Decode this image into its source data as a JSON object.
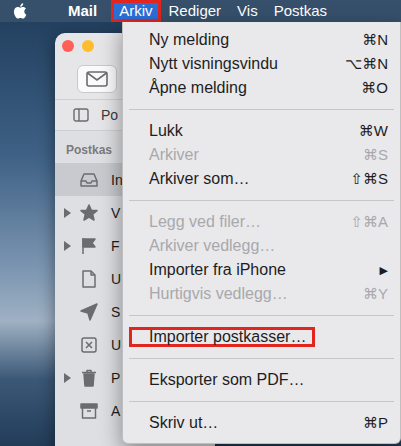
{
  "menubar": {
    "items": [
      {
        "label": "Mail",
        "kind": "app",
        "selected": false,
        "highlighted": false
      },
      {
        "label": "Arkiv",
        "kind": "menu",
        "selected": true,
        "highlighted": true
      },
      {
        "label": "Rediger",
        "kind": "menu",
        "selected": false,
        "highlighted": false
      },
      {
        "label": "Vis",
        "kind": "menu",
        "selected": false,
        "highlighted": false
      },
      {
        "label": "Postkas",
        "kind": "menu",
        "selected": false,
        "highlighted": false
      }
    ]
  },
  "mail_window": {
    "tab_label": "Po",
    "sidebar_header": "Postkas",
    "sidebar_items": [
      {
        "label": "In",
        "kind": "inbox",
        "expandable": false,
        "selected": true
      },
      {
        "label": "V",
        "kind": "star",
        "expandable": true,
        "selected": false
      },
      {
        "label": "F",
        "kind": "flag",
        "expandable": true,
        "selected": false
      },
      {
        "label": "U",
        "kind": "draft",
        "expandable": false,
        "selected": false
      },
      {
        "label": "S",
        "kind": "sent",
        "expandable": false,
        "selected": false
      },
      {
        "label": "U",
        "kind": "junk",
        "expandable": false,
        "selected": false
      },
      {
        "label": "P",
        "kind": "trash",
        "expandable": true,
        "selected": false
      },
      {
        "label": "A",
        "kind": "archive",
        "expandable": false,
        "selected": false
      }
    ]
  },
  "menu": {
    "entries": [
      {
        "kind": "item",
        "label": "Ny melding",
        "shortcut": "⌘N",
        "disabled": false,
        "highlighted": false
      },
      {
        "kind": "item",
        "label": "Nytt visningsvindu",
        "shortcut": "⌥⌘N",
        "disabled": false,
        "highlighted": false
      },
      {
        "kind": "item",
        "label": "Åpne melding",
        "shortcut": "⌘O",
        "disabled": false,
        "highlighted": false
      },
      {
        "kind": "separator"
      },
      {
        "kind": "item",
        "label": "Lukk",
        "shortcut": "⌘W",
        "disabled": false,
        "highlighted": false
      },
      {
        "kind": "item",
        "label": "Arkiver",
        "shortcut": "⌘S",
        "disabled": true,
        "highlighted": false
      },
      {
        "kind": "item",
        "label": "Arkiver som…",
        "shortcut": "⇧⌘S",
        "disabled": false,
        "highlighted": false
      },
      {
        "kind": "separator"
      },
      {
        "kind": "item",
        "label": "Legg ved filer…",
        "shortcut": "⇧⌘A",
        "disabled": true,
        "highlighted": false
      },
      {
        "kind": "item",
        "label": "Arkiver vedlegg…",
        "shortcut": "",
        "disabled": true,
        "highlighted": false
      },
      {
        "kind": "item",
        "label": "Importer fra iPhone",
        "shortcut": "▶",
        "disabled": false,
        "highlighted": false
      },
      {
        "kind": "item",
        "label": "Hurtigvis vedlegg…",
        "shortcut": "⌘Y",
        "disabled": true,
        "highlighted": false
      },
      {
        "kind": "separator"
      },
      {
        "kind": "item",
        "label": "Importer postkasser…",
        "shortcut": "",
        "disabled": false,
        "highlighted": true
      },
      {
        "kind": "separator"
      },
      {
        "kind": "item",
        "label": "Eksporter som PDF…",
        "shortcut": "",
        "disabled": false,
        "highlighted": false
      },
      {
        "kind": "separator"
      },
      {
        "kind": "item",
        "label": "Skriv ut…",
        "shortcut": "⌘P",
        "disabled": false,
        "highlighted": false
      }
    ]
  }
}
